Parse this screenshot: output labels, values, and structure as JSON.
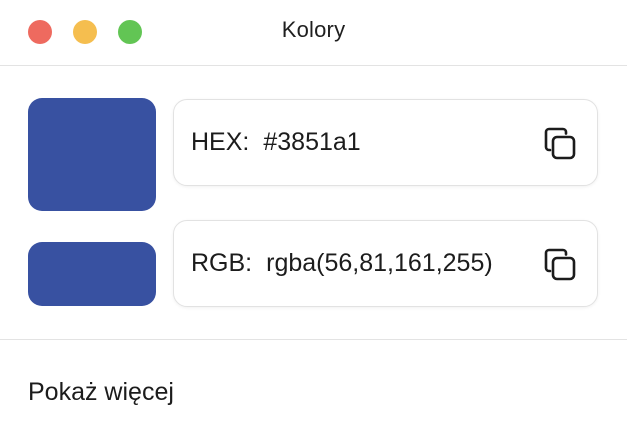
{
  "window": {
    "title": "Kolory"
  },
  "color": {
    "value": "#3851a1"
  },
  "fields": {
    "hex": {
      "label": "HEX:",
      "value": "#3851a1",
      "copy_icon": "copy-icon"
    },
    "rgb": {
      "label": "RGB:",
      "value": "rgba(56,81,161,255)",
      "copy_icon": "copy-icon"
    }
  },
  "footer": {
    "more_label": "Pokaż więcej"
  },
  "colors": {
    "close": "#ee6a5f",
    "minimize": "#f5be4f",
    "maximize": "#62c554",
    "swatch": "#3851a1"
  }
}
